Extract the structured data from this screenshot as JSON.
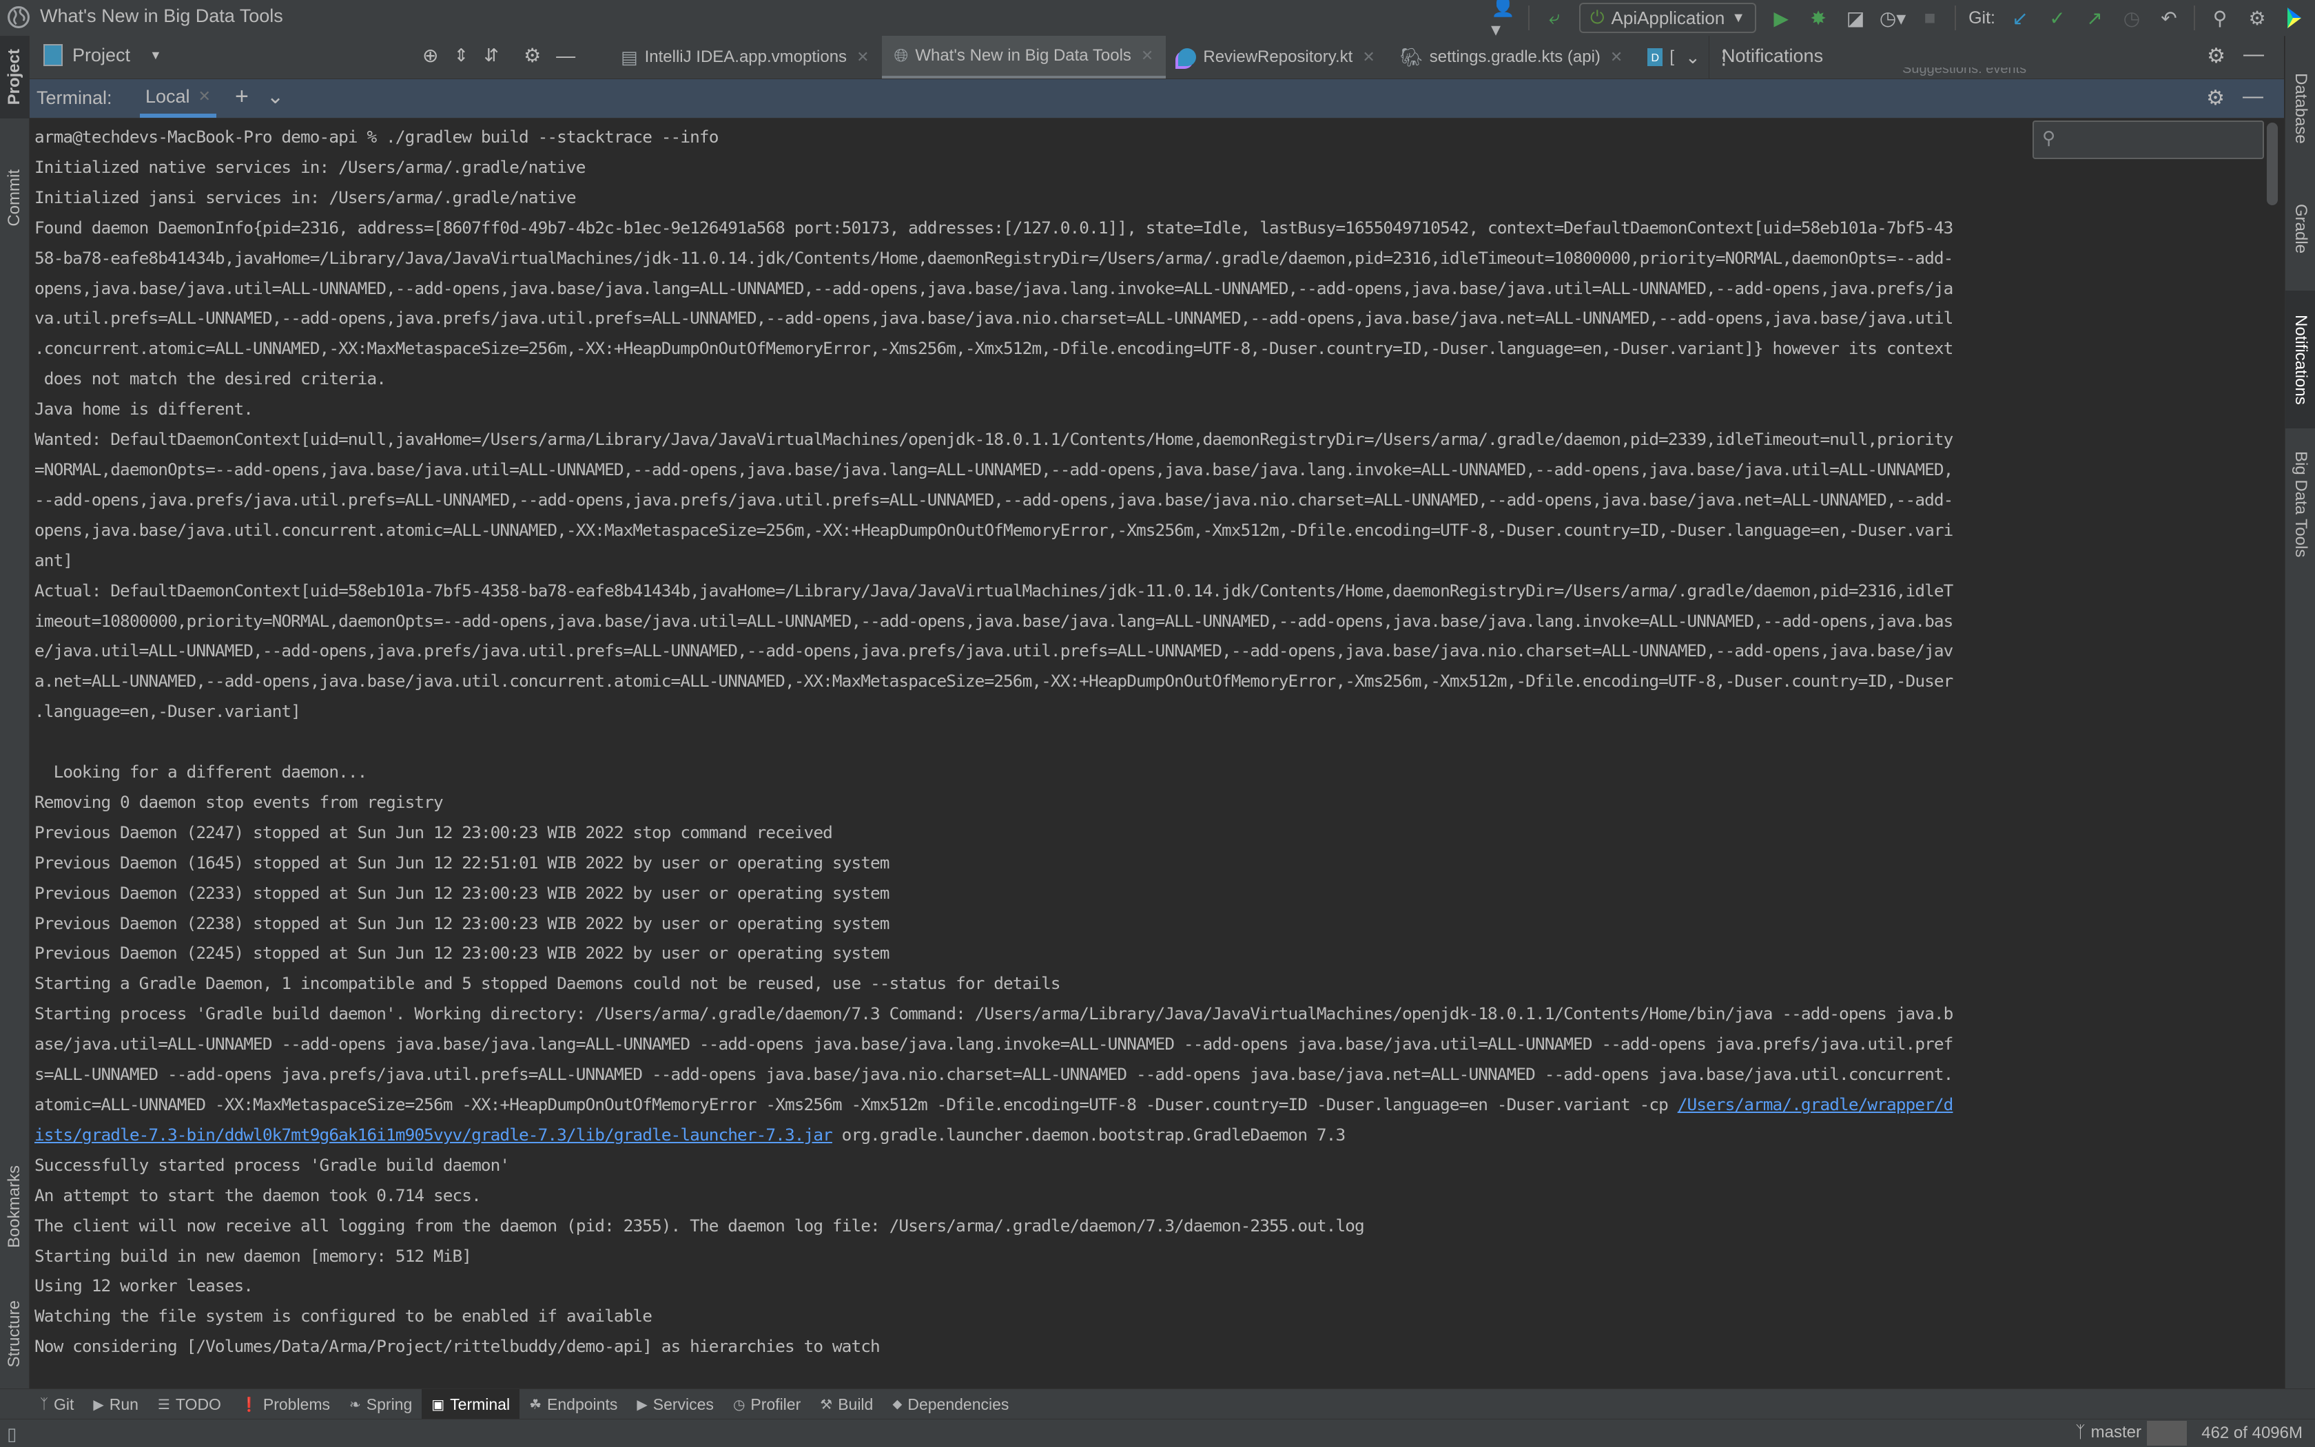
{
  "titlebar": {
    "title": "What's New in Big Data Tools",
    "run_config": "ApiApplication",
    "git_label": "Git:"
  },
  "left_strip": {
    "top": [
      "Project",
      "Commit"
    ],
    "bottom": [
      "Bookmarks",
      "Structure"
    ]
  },
  "right_strip": [
    "Database",
    "Gradle",
    "Notifications",
    "Big Data Tools"
  ],
  "project_panel": {
    "label": "Project"
  },
  "editor_tabs": [
    {
      "label": "IntelliJ IDEA.app.vmoptions",
      "icon": "file-text-icon",
      "active": false
    },
    {
      "label": "What's New in Big Data Tools",
      "icon": "globe-icon",
      "active": true
    },
    {
      "label": "ReviewRepository.kt",
      "icon": "kotlin-class-icon",
      "active": false
    },
    {
      "label": "settings.gradle.kts (api)",
      "icon": "gradle-kotlin-icon",
      "active": false
    },
    {
      "label": "[",
      "icon": "big-data-file-icon",
      "active": false
    }
  ],
  "notifications": {
    "title": "Notifications",
    "peek_text": "Suggestions: events"
  },
  "terminal": {
    "label": "Terminal:",
    "tab": "Local",
    "lines": [
      "arma@techdevs-MacBook-Pro demo-api % ./gradlew build --stacktrace --info",
      "Initialized native services in: /Users/arma/.gradle/native",
      "Initialized jansi services in: /Users/arma/.gradle/native",
      "Found daemon DaemonInfo{pid=2316, address=[8607ff0d-49b7-4b2c-b1ec-9e126491a568 port:50173, addresses:[/127.0.0.1]], state=Idle, lastBusy=1655049710542, context=DefaultDaemonContext[uid=58eb101a-7bf5-43",
      "58-ba78-eafe8b41434b,javaHome=/Library/Java/JavaVirtualMachines/jdk-11.0.14.jdk/Contents/Home,daemonRegistryDir=/Users/arma/.gradle/daemon,pid=2316,idleTimeout=10800000,priority=NORMAL,daemonOpts=--add-",
      "opens,java.base/java.util=ALL-UNNAMED,--add-opens,java.base/java.lang=ALL-UNNAMED,--add-opens,java.base/java.lang.invoke=ALL-UNNAMED,--add-opens,java.base/java.util=ALL-UNNAMED,--add-opens,java.prefs/ja",
      "va.util.prefs=ALL-UNNAMED,--add-opens,java.prefs/java.util.prefs=ALL-UNNAMED,--add-opens,java.base/java.nio.charset=ALL-UNNAMED,--add-opens,java.base/java.net=ALL-UNNAMED,--add-opens,java.base/java.util",
      ".concurrent.atomic=ALL-UNNAMED,-XX:MaxMetaspaceSize=256m,-XX:+HeapDumpOnOutOfMemoryError,-Xms256m,-Xmx512m,-Dfile.encoding=UTF-8,-Duser.country=ID,-Duser.language=en,-Duser.variant]} however its context",
      " does not match the desired criteria.",
      "Java home is different.",
      "Wanted: DefaultDaemonContext[uid=null,javaHome=/Users/arma/Library/Java/JavaVirtualMachines/openjdk-18.0.1.1/Contents/Home,daemonRegistryDir=/Users/arma/.gradle/daemon,pid=2339,idleTimeout=null,priority",
      "=NORMAL,daemonOpts=--add-opens,java.base/java.util=ALL-UNNAMED,--add-opens,java.base/java.lang=ALL-UNNAMED,--add-opens,java.base/java.lang.invoke=ALL-UNNAMED,--add-opens,java.base/java.util=ALL-UNNAMED,",
      "--add-opens,java.prefs/java.util.prefs=ALL-UNNAMED,--add-opens,java.prefs/java.util.prefs=ALL-UNNAMED,--add-opens,java.base/java.nio.charset=ALL-UNNAMED,--add-opens,java.base/java.net=ALL-UNNAMED,--add-",
      "opens,java.base/java.util.concurrent.atomic=ALL-UNNAMED,-XX:MaxMetaspaceSize=256m,-XX:+HeapDumpOnOutOfMemoryError,-Xms256m,-Xmx512m,-Dfile.encoding=UTF-8,-Duser.country=ID,-Duser.language=en,-Duser.vari",
      "ant]",
      "Actual: DefaultDaemonContext[uid=58eb101a-7bf5-4358-ba78-eafe8b41434b,javaHome=/Library/Java/JavaVirtualMachines/jdk-11.0.14.jdk/Contents/Home,daemonRegistryDir=/Users/arma/.gradle/daemon,pid=2316,idleT",
      "imeout=10800000,priority=NORMAL,daemonOpts=--add-opens,java.base/java.util=ALL-UNNAMED,--add-opens,java.base/java.lang=ALL-UNNAMED,--add-opens,java.base/java.lang.invoke=ALL-UNNAMED,--add-opens,java.bas",
      "e/java.util=ALL-UNNAMED,--add-opens,java.prefs/java.util.prefs=ALL-UNNAMED,--add-opens,java.prefs/java.util.prefs=ALL-UNNAMED,--add-opens,java.base/java.nio.charset=ALL-UNNAMED,--add-opens,java.base/jav",
      "a.net=ALL-UNNAMED,--add-opens,java.base/java.util.concurrent.atomic=ALL-UNNAMED,-XX:MaxMetaspaceSize=256m,-XX:+HeapDumpOnOutOfMemoryError,-Xms256m,-Xmx512m,-Dfile.encoding=UTF-8,-Duser.country=ID,-Duser",
      ".language=en,-Duser.variant]",
      "",
      "  Looking for a different daemon...",
      "Removing 0 daemon stop events from registry",
      "Previous Daemon (2247) stopped at Sun Jun 12 23:00:23 WIB 2022 stop command received",
      "Previous Daemon (1645) stopped at Sun Jun 12 22:51:01 WIB 2022 by user or operating system",
      "Previous Daemon (2233) stopped at Sun Jun 12 23:00:23 WIB 2022 by user or operating system",
      "Previous Daemon (2238) stopped at Sun Jun 12 23:00:23 WIB 2022 by user or operating system",
      "Previous Daemon (2245) stopped at Sun Jun 12 23:00:23 WIB 2022 by user or operating system",
      "Starting a Gradle Daemon, 1 incompatible and 5 stopped Daemons could not be reused, use --status for details",
      "Starting process 'Gradle build daemon'. Working directory: /Users/arma/.gradle/daemon/7.3 Command: /Users/arma/Library/Java/JavaVirtualMachines/openjdk-18.0.1.1/Contents/Home/bin/java --add-opens java.b",
      "ase/java.util=ALL-UNNAMED --add-opens java.base/java.lang=ALL-UNNAMED --add-opens java.base/java.lang.invoke=ALL-UNNAMED --add-opens java.base/java.util=ALL-UNNAMED --add-opens java.prefs/java.util.pref",
      "s=ALL-UNNAMED --add-opens java.prefs/java.util.prefs=ALL-UNNAMED --add-opens java.base/java.nio.charset=ALL-UNNAMED --add-opens java.base/java.net=ALL-UNNAMED --add-opens java.base/java.util.concurrent.",
      {
        "text": "atomic=ALL-UNNAMED -XX:MaxMetaspaceSize=256m -XX:+HeapDumpOnOutOfMemoryError -Xms256m -Xmx512m -Dfile.encoding=UTF-8 -Duser.country=ID -Duser.language=en -Duser.variant -cp ",
        "link": "/Users/arma/.gradle/wrapper/d",
        "after": ""
      },
      {
        "text": "",
        "link": "ists/gradle-7.3-bin/ddwl0k7mt9g6ak16i1m905vyv/gradle-7.3/lib/gradle-launcher-7.3.jar",
        "after": " org.gradle.launcher.daemon.bootstrap.GradleDaemon 7.3"
      },
      "Successfully started process 'Gradle build daemon'",
      "An attempt to start the daemon took 0.714 secs.",
      "The client will now receive all logging from the daemon (pid: 2355). The daemon log file: /Users/arma/.gradle/daemon/7.3/daemon-2355.out.log",
      "Starting build in new daemon [memory: 512 MiB]",
      "Using 12 worker leases.",
      "Watching the file system is configured to be enabled if available",
      "Now considering [/Volumes/Data/Arma/Project/rittelbuddy/demo-api] as hierarchies to watch"
    ]
  },
  "bottom_tools": [
    {
      "label": "Git",
      "icon": "git-branch-icon"
    },
    {
      "label": "Run",
      "icon": "run-icon"
    },
    {
      "label": "TODO",
      "icon": "todo-list-icon"
    },
    {
      "label": "Problems",
      "icon": "problems-icon"
    },
    {
      "label": "Spring",
      "icon": "spring-leaf-icon"
    },
    {
      "label": "Terminal",
      "icon": "terminal-icon",
      "active": true
    },
    {
      "label": "Endpoints",
      "icon": "endpoints-icon"
    },
    {
      "label": "Services",
      "icon": "services-icon"
    },
    {
      "label": "Profiler",
      "icon": "profiler-icon"
    },
    {
      "label": "Build",
      "icon": "build-hammer-icon"
    },
    {
      "label": "Dependencies",
      "icon": "dependencies-icon"
    }
  ],
  "statusbar": {
    "branch": "master",
    "memory": "462 of 4096M",
    "memory_used_fraction": 0.113
  },
  "colors": {
    "accent": "#4a88c7",
    "link": "#589df6",
    "run_green": "#499c54",
    "git_blue": "#3592c4"
  }
}
